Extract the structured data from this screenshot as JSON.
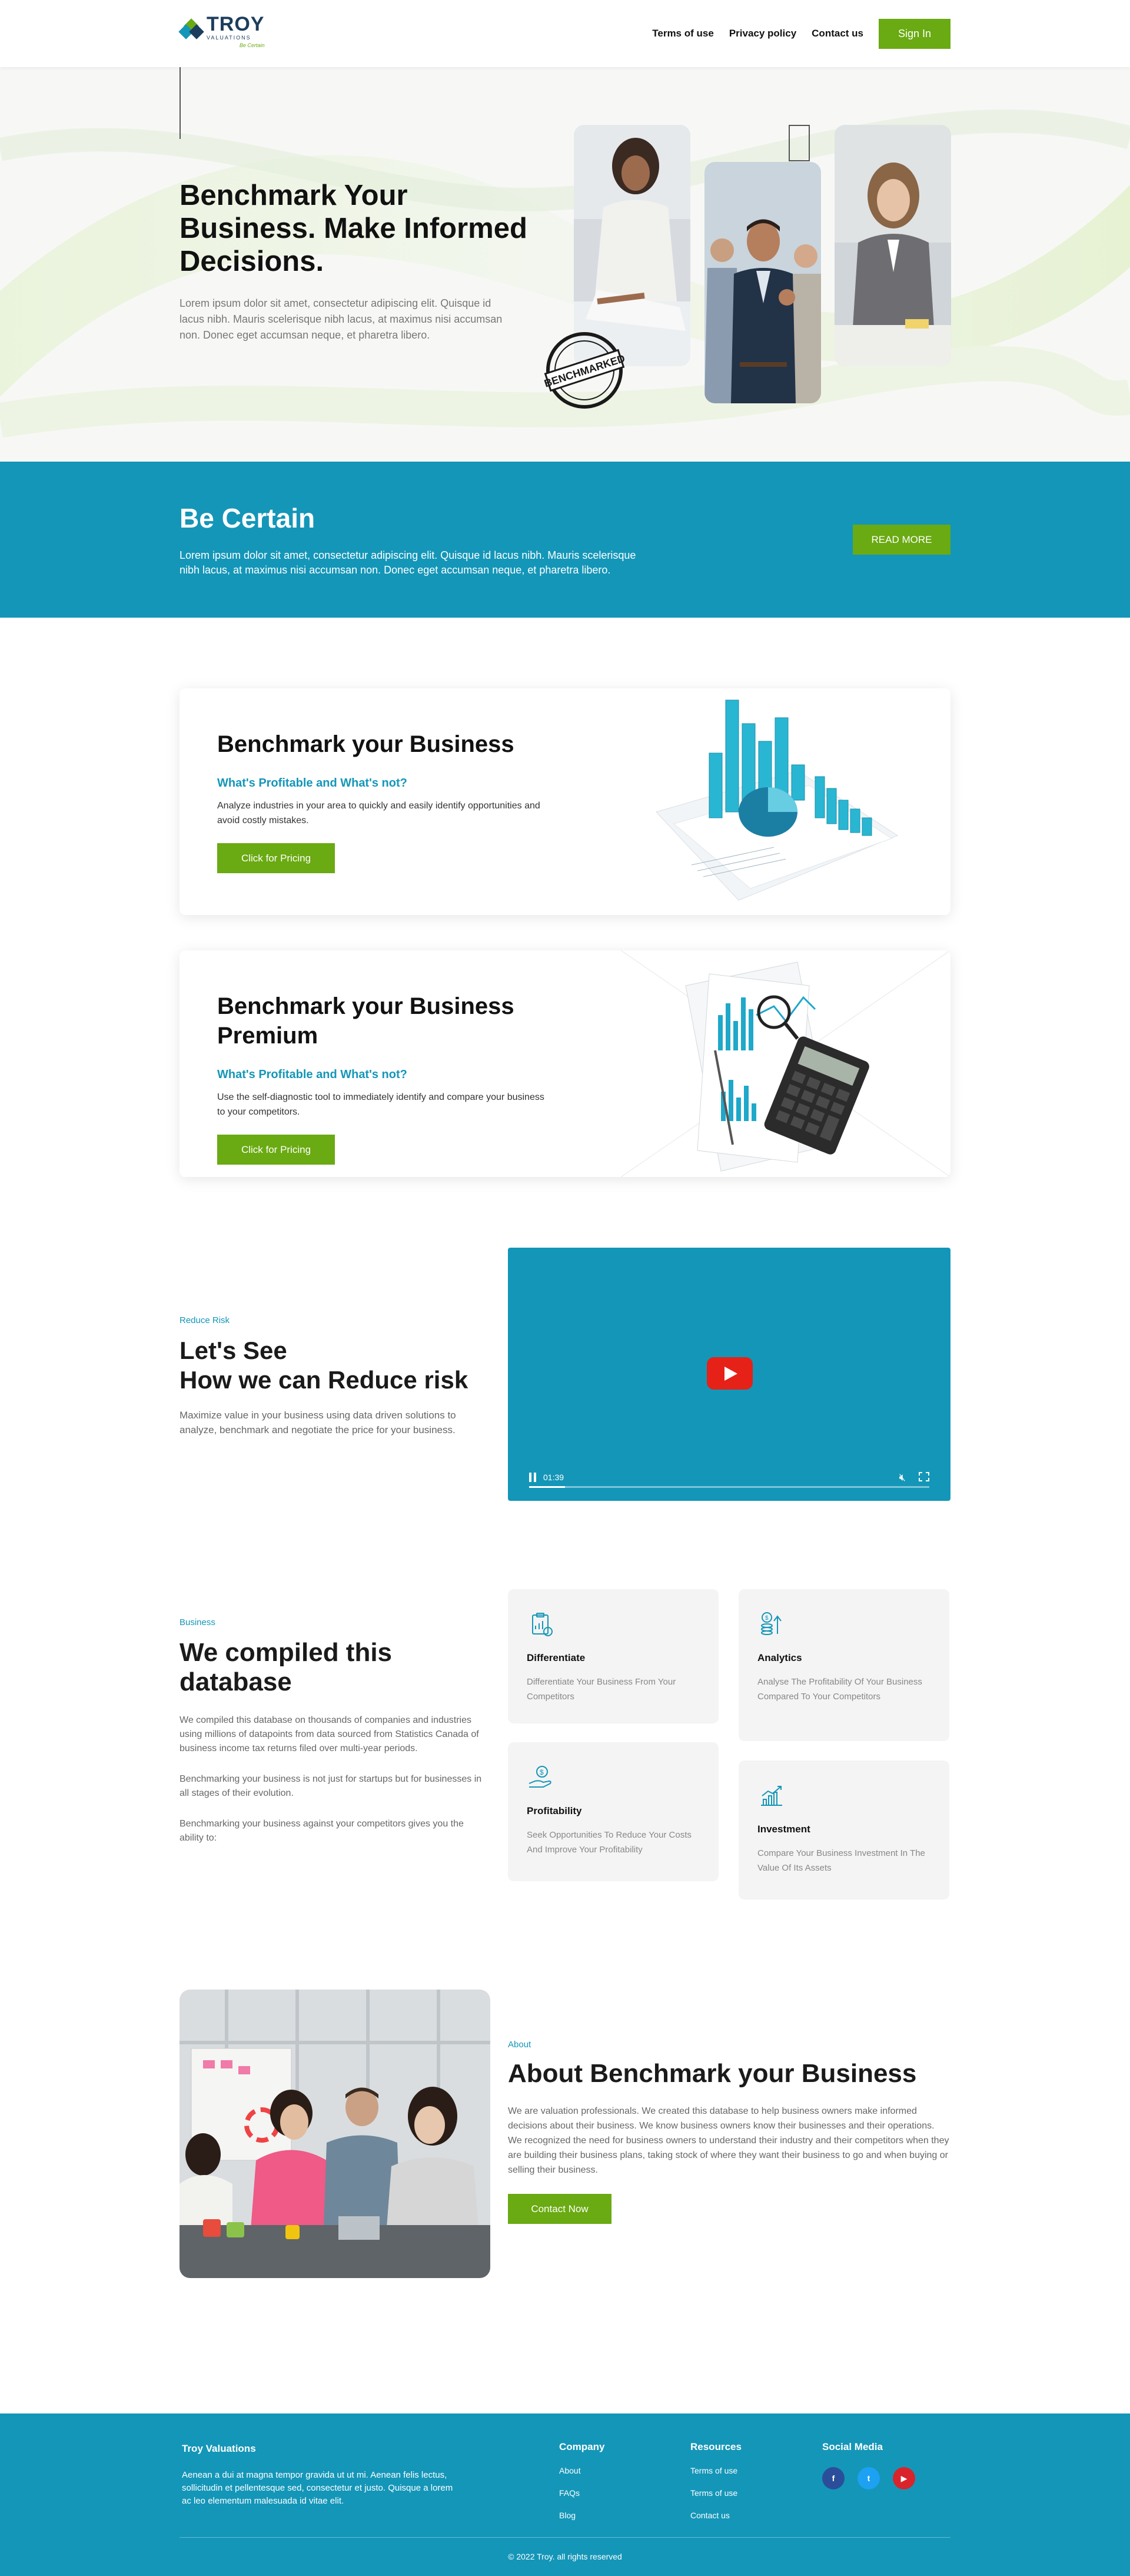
{
  "header": {
    "logo_title": "TROY",
    "logo_sub": "VALUATIONS",
    "logo_tag": "Be Certain",
    "nav": [
      "Terms of use",
      "Privacy policy",
      "Contact us"
    ],
    "signin": "Sign In"
  },
  "hero": {
    "title": "Benchmark Your Business. Make Informed Decisions.",
    "body": "Lorem ipsum dolor sit amet, consectetur adipiscing elit. Quisque id lacus nibh. Mauris scelerisque nibh lacus, at maximus nisi accumsan non. Donec eget accumsan neque, et pharetra libero.",
    "stamp_text": "BENCHMARKED"
  },
  "band": {
    "title": "Be Certain",
    "body": "Lorem ipsum dolor sit amet, consectetur adipiscing elit.  Quisque id lacus nibh. Mauris scelerisque nibh lacus, at maximus nisi accumsan non. Donec eget accumsan neque, et pharetra libero.",
    "button": "READ MORE"
  },
  "cards": [
    {
      "title": "Benchmark your Business",
      "subtitle": "What's Profitable and What's not?",
      "body": "Analyze industries in your area to quickly and easily identify opportunities and avoid costly mistakes.",
      "button": "Click for Pricing"
    },
    {
      "title": "Benchmark your Business Premium",
      "subtitle": "What's Profitable and What's not?",
      "body": "Use the self-diagnostic tool to immediately identify and compare your business to your competitors.",
      "button": "Click for Pricing"
    }
  ],
  "video": {
    "eyebrow": "Reduce Risk",
    "title_line1": "Let's See",
    "title_line2": "How we can Reduce risk",
    "body": "Maximize value  in your business using data driven solutions to analyze, benchmark and negotiate the price for your business.",
    "time": "01:39",
    "progress": 0.09
  },
  "database": {
    "eyebrow": "Business",
    "title": "We compiled this database",
    "paragraphs": [
      "We compiled this database on thousands of companies and industries using millions of datapoints from data sourced from Statistics Canada of business income tax returns filed over multi-year periods.",
      "Benchmarking your business is not just for startups but for businesses in all stages of their evolution.",
      "Benchmarking your business against your competitors gives you the ability to:"
    ],
    "features": [
      {
        "title": "Differentiate",
        "body": "Differentiate Your Business From Your Competitors",
        "icon": "clipboard-chart-icon"
      },
      {
        "title": "Analytics",
        "body": "Analyse The Profitability Of Your Business Compared To Your Competitors",
        "icon": "coins-growth-icon"
      },
      {
        "title": "Profitability",
        "body": "Seek Opportunities To Reduce Your Costs And Improve Your Profitability",
        "icon": "hand-dollar-icon"
      },
      {
        "title": "Investment",
        "body": "Compare Your Business Investment In The Value Of Its Assets",
        "icon": "bar-chart-growth-icon"
      }
    ]
  },
  "about": {
    "eyebrow": "About",
    "title": "About Benchmark your Business",
    "body": "We are valuation professionals. We created this database to help business owners make informed decisions about their business. We know business owners know their businesses and their operations. We recognized the need for business owners to understand their industry and their competitors when they are building their business plans, taking stock of where they want their business to go and when buying or selling their business.",
    "button": "Contact Now"
  },
  "footer": {
    "brand": "Troy Valuations",
    "brand_body": "Aenean a dui at magna tempor gravida ut ut mi. Aenean felis lectus, sollicitudin et pellentesque sed, consectetur et justo. Quisque a lorem ac leo elementum malesuada id vitae elit.",
    "company_title": "Company",
    "company_links": [
      "About",
      "FAQs",
      "Blog"
    ],
    "resources_title": "Resources",
    "resources_links": [
      "Terms of use",
      "Terms of use",
      "Contact us"
    ],
    "social_title": "Social Media",
    "socials": [
      {
        "icon": "facebook-icon",
        "glyph": "f",
        "color": "#2b4e9b"
      },
      {
        "icon": "twitter-icon",
        "glyph": "t",
        "color": "#1da1f2"
      },
      {
        "icon": "youtube-icon",
        "glyph": "▶",
        "color": "#d9242b"
      }
    ],
    "copyright": "© 2022 Troy. all rights reserved"
  },
  "colors": {
    "brand_blue": "#1496b8",
    "brand_green": "#6aaa12",
    "navy": "#1d3d5c"
  }
}
